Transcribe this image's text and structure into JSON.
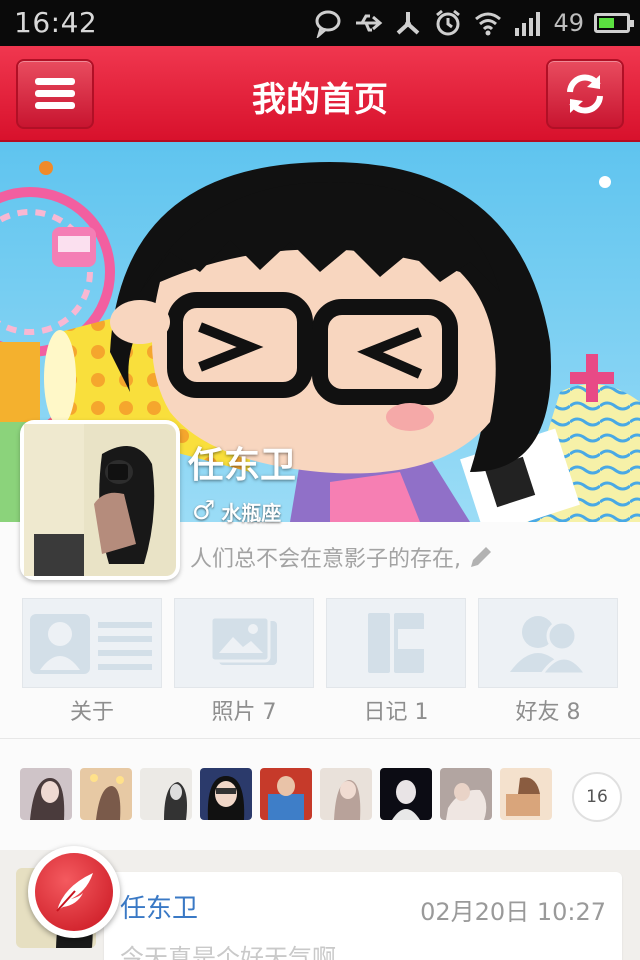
{
  "status_bar": {
    "time": "16:42",
    "battery_level": "49",
    "battery_fraction": 0.49
  },
  "header": {
    "title": "我的首页",
    "menu_icon": "menu-icon",
    "refresh_icon": "refresh-icon",
    "accent": "#e0233b"
  },
  "profile": {
    "name": "任东卫",
    "gender_symbol": "♂",
    "zodiac": "水瓶座",
    "signature": "人们总不会在意影子的存在,"
  },
  "tiles": [
    {
      "label": "关于",
      "icon": "about-icon"
    },
    {
      "label": "照片 7",
      "icon": "photo-icon"
    },
    {
      "label": "日记 1",
      "icon": "diary-icon"
    },
    {
      "label": "好友 8",
      "icon": "friends-icon"
    }
  ],
  "friends_strip": {
    "more_count": "16",
    "thumb_count": 9
  },
  "feed": {
    "author": "任东卫",
    "time": "02月20日 10:27",
    "text": "今天真是个好天气啊"
  }
}
